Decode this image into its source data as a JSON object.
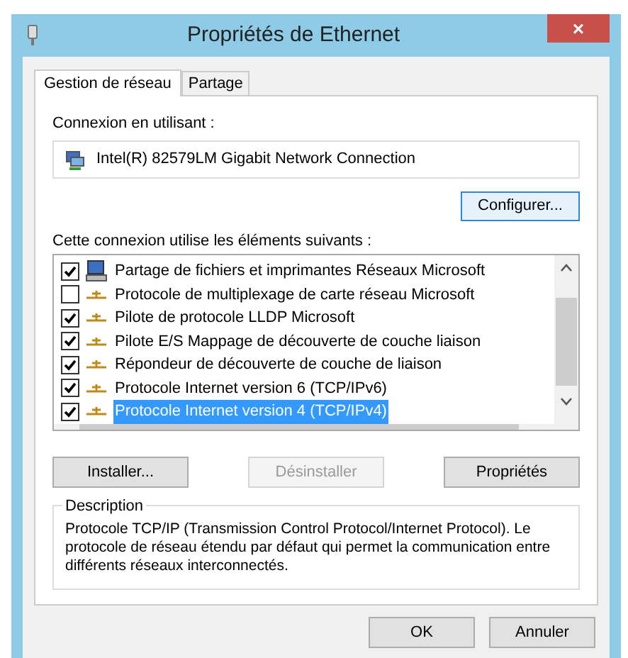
{
  "window": {
    "title": "Propriétés de Ethernet",
    "close": "×"
  },
  "tabs": [
    {
      "label": "Gestion de réseau",
      "selected": true
    },
    {
      "label": "Partage",
      "selected": false
    }
  ],
  "connection_label": "Connexion en utilisant :",
  "adapter": "Intel(R) 82579LM Gigabit Network Connection",
  "configure_button": "Configurer...",
  "items_label": "Cette connexion utilise les éléments suivants :",
  "items": [
    {
      "kind": "share",
      "label": "Partage de fichiers et imprimantes Réseaux Microsoft",
      "checked": true,
      "selected": false
    },
    {
      "kind": "protocol",
      "label": "Protocole de multiplexage de carte réseau Microsoft",
      "checked": false,
      "selected": false
    },
    {
      "kind": "protocol",
      "label": "Pilote de protocole LLDP Microsoft",
      "checked": true,
      "selected": false
    },
    {
      "kind": "protocol",
      "label": "Pilote E/S Mappage de découverte de couche liaison",
      "checked": true,
      "selected": false
    },
    {
      "kind": "protocol",
      "label": "Répondeur de découverte de couche de liaison",
      "checked": true,
      "selected": false
    },
    {
      "kind": "protocol",
      "label": "Protocole Internet version 6 (TCP/IPv6)",
      "checked": true,
      "selected": false
    },
    {
      "kind": "protocol",
      "label": "Protocole Internet version 4 (TCP/IPv4)",
      "checked": true,
      "selected": true
    }
  ],
  "action_buttons": [
    {
      "label": "Installer...",
      "disabled": false
    },
    {
      "label": "Désinstaller",
      "disabled": true
    },
    {
      "label": "Propriétés",
      "disabled": false
    }
  ],
  "description": {
    "title": "Description",
    "text": "Protocole TCP/IP (Transmission Control Protocol/Internet Protocol). Le protocole de réseau étendu par défaut qui permet la communication entre différents réseaux interconnectés."
  },
  "footer_buttons": [
    "OK",
    "Annuler"
  ]
}
